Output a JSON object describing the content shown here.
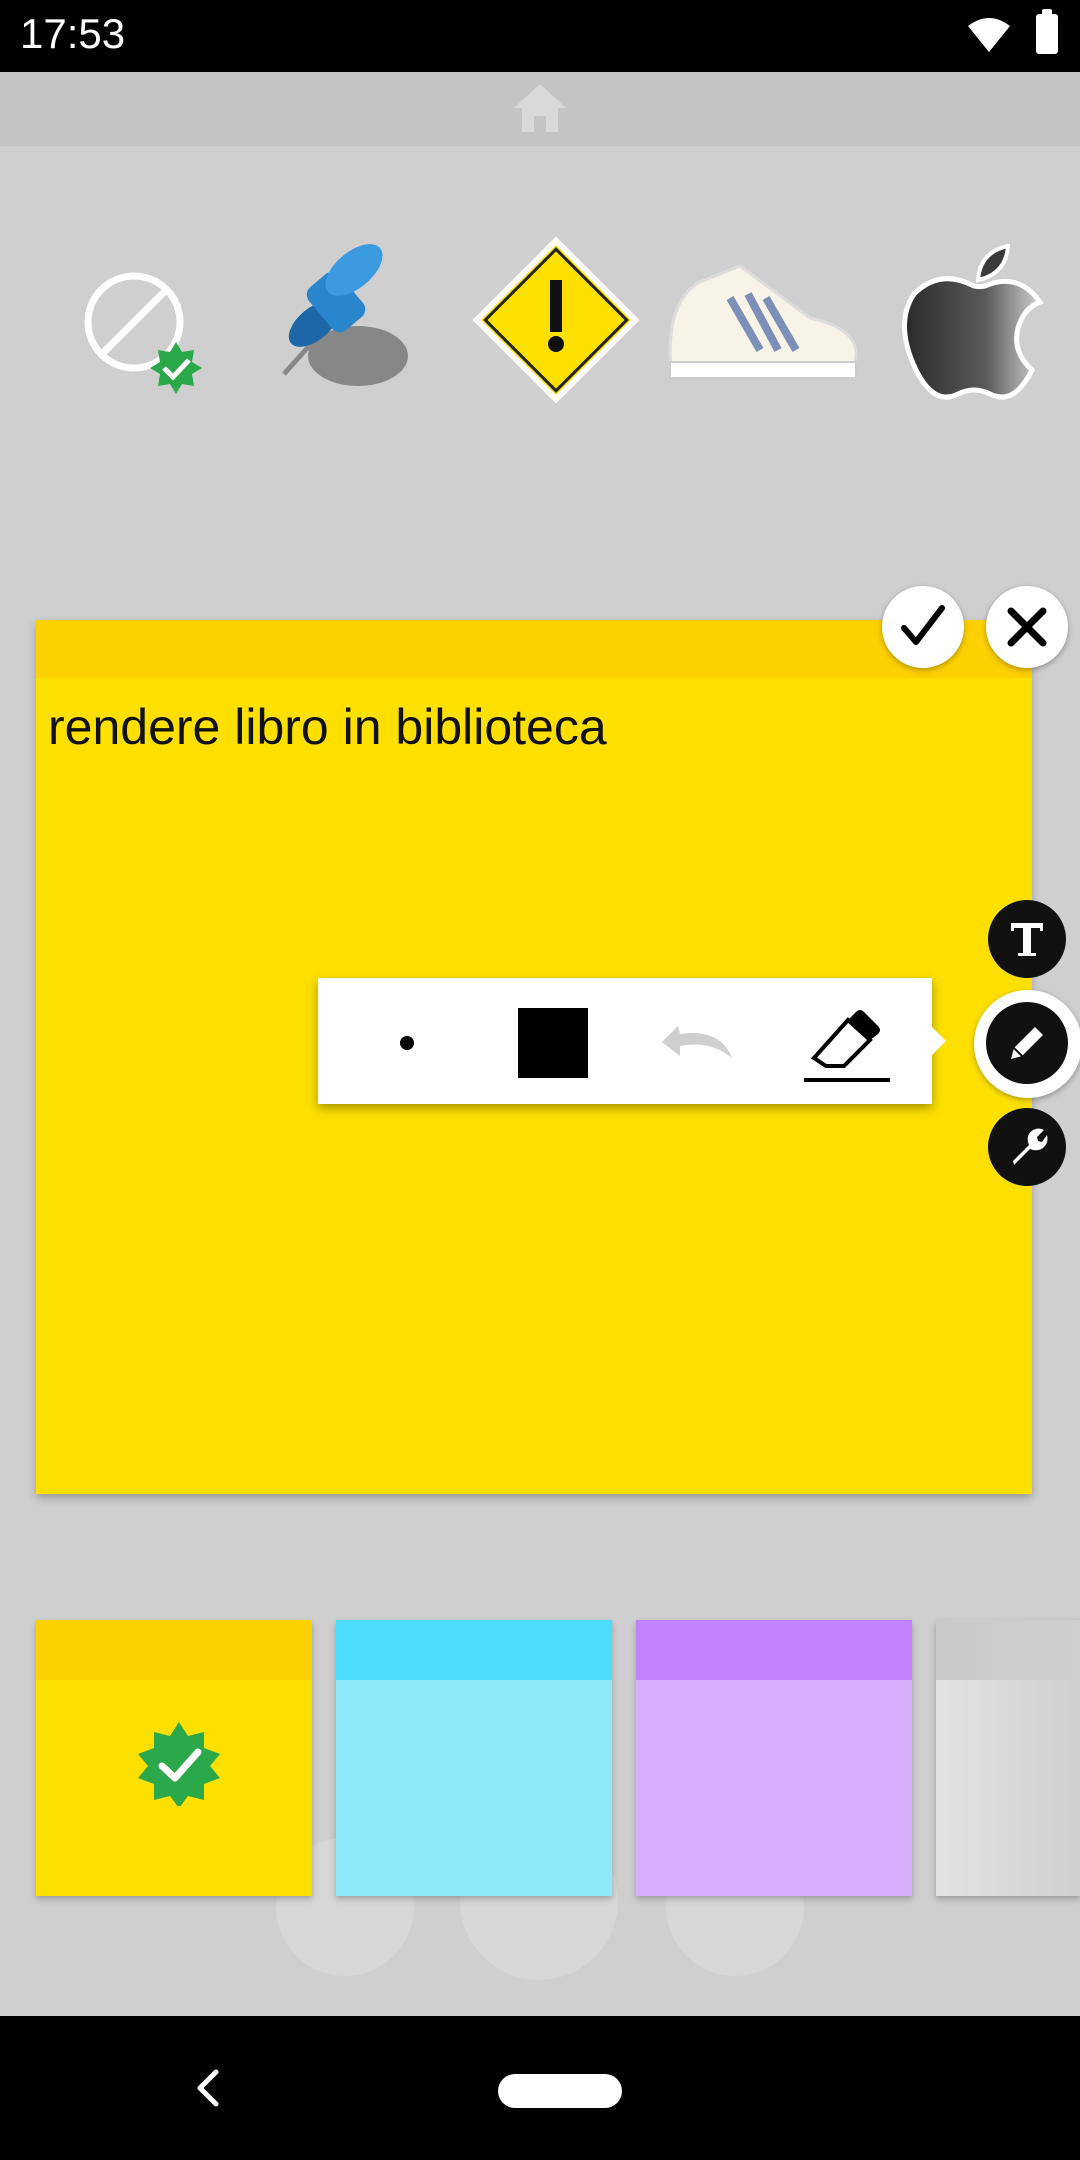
{
  "status_bar": {
    "time": "17:53",
    "icons": [
      "wifi-icon",
      "battery-icon"
    ]
  },
  "header": {
    "icon": "home-icon"
  },
  "stickers": [
    {
      "name": "blocked-verified-sticker"
    },
    {
      "name": "blue-pushpin-sticker"
    },
    {
      "name": "warning-sign-sticker"
    },
    {
      "name": "sneaker-sticker"
    },
    {
      "name": "apple-logo-sticker"
    }
  ],
  "note": {
    "text": "rendere libro in biblioteca",
    "color": "#fde000",
    "strip_color": "#fdd000"
  },
  "note_actions": {
    "confirm_icon": "checkmark-icon",
    "cancel_icon": "close-icon"
  },
  "tools": {
    "text_tool_icon": "text-T-icon",
    "draw_tool_icon": "pencil-icon",
    "settings_tool_icon": "wrench-icon"
  },
  "draw_toolbar": {
    "items": [
      "brush-size-dot",
      "color-square",
      "undo-icon",
      "eraser-icon"
    ],
    "brush_color": "#000000"
  },
  "swatches": [
    {
      "name": "yellow",
      "top": "#fdd000",
      "body": "#fde000",
      "selected": true
    },
    {
      "name": "cyan",
      "top": "#4ddcfc",
      "body": "#90e8fb",
      "selected": false
    },
    {
      "name": "purple",
      "top": "#c282fb",
      "body": "#d6b0fb",
      "selected": false
    },
    {
      "name": "gray",
      "top": "#c9c9c9",
      "body": "#e3e3e3",
      "selected": false
    }
  ],
  "nav_bar": {
    "icons": [
      "back-icon",
      "home-pill"
    ]
  }
}
